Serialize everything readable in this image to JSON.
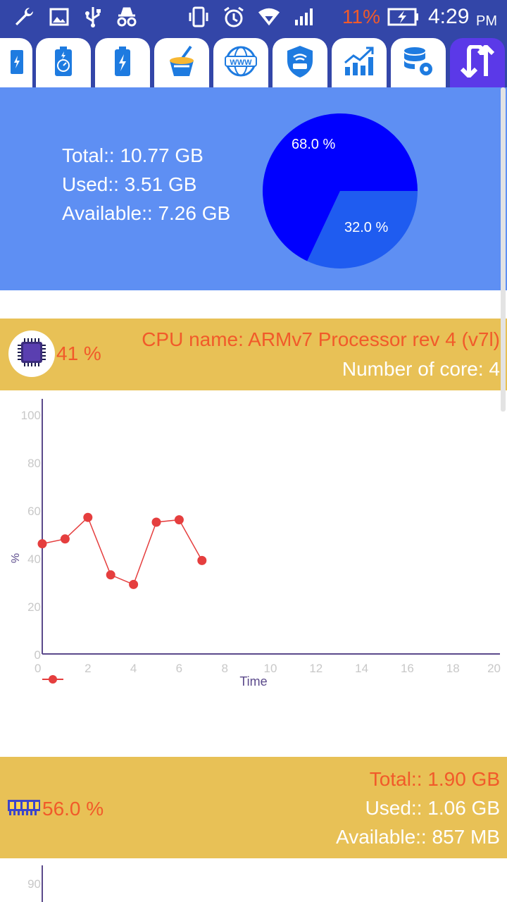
{
  "status_bar": {
    "battery_percent": "11%",
    "time": "4:29",
    "ampm": "PM",
    "colors": {
      "bar": "#3346a8",
      "battery_text": "#f15a2a"
    },
    "icons": [
      "wrench-icon",
      "image-icon",
      "usb-icon",
      "incognito-icon",
      "vibrate-icon",
      "alarm-icon",
      "wifi-icon",
      "signal-icon",
      "battery-charging-icon"
    ]
  },
  "tabs": [
    {
      "icon": "battery-charge-icon",
      "active": false
    },
    {
      "icon": "battery-speed-icon",
      "active": false
    },
    {
      "icon": "battery-bolt-icon",
      "active": false
    },
    {
      "icon": "cleaner-icon",
      "active": false
    },
    {
      "icon": "www-icon",
      "active": false
    },
    {
      "icon": "router-icon",
      "active": false
    },
    {
      "icon": "growth-chart-icon",
      "active": false
    },
    {
      "icon": "database-settings-icon",
      "active": false
    },
    {
      "icon": "data-transfer-icon",
      "active": true
    }
  ],
  "storage": {
    "total": "Total:: 10.77 GB",
    "used": "Used:: 3.51 GB",
    "available": "Available:: 7.26 GB",
    "pie_slices": [
      {
        "label": "68.0 %",
        "value": 68.0,
        "color": "#0000ff"
      },
      {
        "label": "32.0 %",
        "value": 32.0,
        "color": "#1f5cf0"
      }
    ],
    "background": "#5e8ff3"
  },
  "cpu": {
    "percent": "41 %",
    "name": "CPU name: ARMv7 Processor rev 4 (v7l)",
    "cores": "Number of core: 4",
    "background": "#e8c156"
  },
  "chart_data": {
    "type": "line",
    "x": [
      0,
      1,
      2,
      3,
      4,
      5,
      6,
      7
    ],
    "series": [
      {
        "values": [
          46,
          48,
          57,
          33,
          29,
          55,
          56,
          39
        ],
        "color": "#e53e3e"
      }
    ],
    "xlabel": "Time",
    "ylabel": "%",
    "xlim": [
      0,
      20
    ],
    "ylim": [
      0,
      100
    ],
    "xticks": [
      "0",
      "2",
      "4",
      "6",
      "8",
      "10",
      "12",
      "14",
      "16",
      "18",
      "20"
    ],
    "yticks": [
      "0",
      "20",
      "40",
      "60",
      "80",
      "100"
    ],
    "legend": "bottom-left"
  },
  "ram": {
    "percent": "56.0 %",
    "total": "Total:: 1.90 GB",
    "used": "Used:: 1.06 GB",
    "available": "Available:: 857 MB"
  },
  "ram_chart": {
    "ytick_top": "90"
  }
}
